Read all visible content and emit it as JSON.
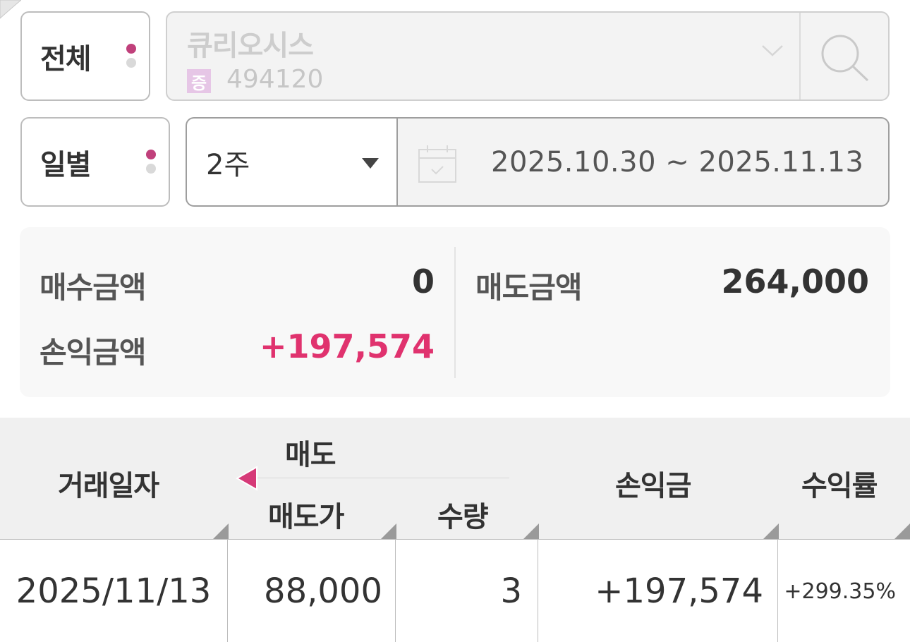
{
  "filter": {
    "scope_label": "전체",
    "stock": {
      "name": "큐리오시스",
      "badge": "증",
      "code": "494120"
    }
  },
  "period": {
    "unit_label": "일별",
    "range_value": "2주",
    "date_range": "2025.10.30 ~ 2025.11.13"
  },
  "summary": {
    "buy_label": "매수금액",
    "buy_value": "0",
    "sell_label": "매도금액",
    "sell_value": "264,000",
    "pnl_label": "손익금액",
    "pnl_value": "+197,574"
  },
  "table": {
    "headers": {
      "date": "거래일자",
      "sell_group": "매도",
      "sell_price": "매도가",
      "quantity": "수량",
      "pnl": "손익금",
      "return_rate": "수익률"
    },
    "rows": [
      {
        "date": "2025/11/13",
        "sell_price": "88,000",
        "quantity": "3",
        "pnl": "+197,574",
        "return_rate": "+299.35%"
      }
    ]
  },
  "colors": {
    "accent_positive": "#e0326e",
    "dot_active": "#c0407b",
    "dot_inactive": "#d9d9d9",
    "header_bg": "#f0f0f0"
  },
  "icons": {
    "search": "search-icon",
    "dropdown": "chevron-down-icon",
    "caret": "caret-down-icon",
    "calendar": "calendar-icon",
    "collapse": "triangle-left-icon"
  }
}
